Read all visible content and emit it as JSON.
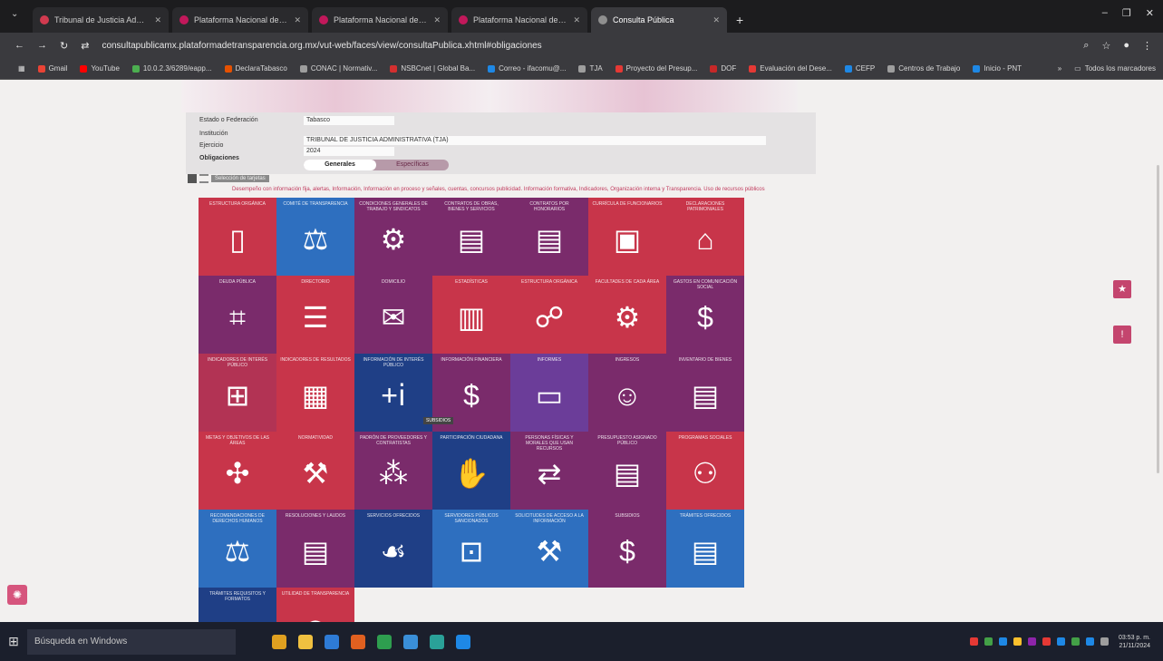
{
  "browser": {
    "tabs": [
      {
        "title": "Tribunal de Justicia Administr...",
        "color": "#d13a4f",
        "active": false
      },
      {
        "title": "Plataforma Nacional de Transp...",
        "color": "#c2185b",
        "active": false
      },
      {
        "title": "Plataforma Nacional de Transp...",
        "color": "#c2185b",
        "active": false
      },
      {
        "title": "Plataforma Nacional de Transp...",
        "color": "#c2185b",
        "active": false
      },
      {
        "title": "Consulta Pública",
        "color": "#8f8f8f",
        "active": true
      }
    ],
    "new_tab": "+",
    "window_controls": {
      "minimize": "–",
      "maximize": "❐",
      "close": "✕"
    },
    "url": "consultapublicamx.plataformadetransparencia.org.mx/vut-web/faces/view/consultaPublica.xhtml#obligaciones",
    "bookmarks": [
      {
        "label": "Gmail",
        "color": "#ea4335"
      },
      {
        "label": "YouTube",
        "color": "#ff0000"
      },
      {
        "label": "10.0.2.3/6289/eapp...",
        "color": "#4caf50"
      },
      {
        "label": "DeclaraTabasco",
        "color": "#e65100"
      },
      {
        "label": "CONAC | Normativ...",
        "color": "#9e9e9e"
      },
      {
        "label": "NSBCnet | Global Ba...",
        "color": "#d32f2f"
      },
      {
        "label": "Correo - ifacomu@...",
        "color": "#1e88e5"
      },
      {
        "label": "TJA",
        "color": "#9e9e9e"
      },
      {
        "label": "Proyecto del Presup...",
        "color": "#e53935"
      },
      {
        "label": "DOF",
        "color": "#c62828"
      },
      {
        "label": "Evaluación del Dese...",
        "color": "#e53935"
      },
      {
        "label": "CEFP",
        "color": "#1e88e5"
      },
      {
        "label": "Centros de Trabajo",
        "color": "#9e9e9e"
      },
      {
        "label": "Inicio - PNT",
        "color": "#1e88e5"
      }
    ],
    "all_bookmarks": "Todos los marcadores"
  },
  "form": {
    "labels": {
      "estado": "Estado o Federación",
      "institucion": "Institución",
      "ejercicio": "Ejercicio",
      "obligaciones": "Obligaciones"
    },
    "values": {
      "estado": "Tabasco",
      "institucion": "TRIBUNAL DE JUSTICIA ADMINISTRATIVA (TJA)",
      "ejercicio": "2024"
    },
    "tabs": {
      "generales": "Generales",
      "especificas": "Específicas"
    },
    "select_button": "Selección de tarjetas",
    "legend": "Desempeño con información fija, alertas, Información, Información en proceso y señales, cuentas, concursos publicidad. Información formativa, Indicadores, Organización interna y Transparencia. Uso de recursos públicos"
  },
  "tiles": [
    {
      "label": "Estructura Orgánica",
      "color": "#c8354a",
      "icon": "▯"
    },
    {
      "label": "Comité de Transparencia",
      "color": "#2e6fbf",
      "icon": "⚖"
    },
    {
      "label": "Condiciones generales de trabajo y sindicatos",
      "color": "#7a2b6b",
      "icon": "⚙"
    },
    {
      "label": "Contratos de obras, bienes y servicios",
      "color": "#7a2b6b",
      "icon": "▤"
    },
    {
      "label": "Contratos por honorarios",
      "color": "#7a2b6b",
      "icon": "▤"
    },
    {
      "label": "Currícula de funcionarios",
      "color": "#c8354a",
      "icon": "▣"
    },
    {
      "label": "Declaraciones patrimoniales",
      "color": "#c8354a",
      "icon": "⌂"
    },
    {
      "label": "Deuda pública",
      "color": "#7a2b6b",
      "icon": "⌗"
    },
    {
      "label": "Directorio",
      "color": "#c8354a",
      "icon": "☰"
    },
    {
      "label": "Domicilio",
      "color": "#7a2b6b",
      "icon": "✉"
    },
    {
      "label": "Estadísticas",
      "color": "#c8354a",
      "icon": "▥"
    },
    {
      "label": "Estructura orgánica",
      "color": "#c8354a",
      "icon": "☍"
    },
    {
      "label": "Facultades de cada área",
      "color": "#c8354a",
      "icon": "⚙"
    },
    {
      "label": "Gastos en comunicación social",
      "color": "#7a2b6b",
      "icon": "$"
    },
    {
      "label": "Indicadores de interés público",
      "color": "#b23354",
      "icon": "⊞"
    },
    {
      "label": "Indicadores de resultados",
      "color": "#c8354a",
      "icon": "▦"
    },
    {
      "label": "Información de interés público",
      "color": "#1f3f86",
      "icon": "+ⅰ"
    },
    {
      "label": "Información financiera",
      "color": "#7a2b6b",
      "icon": "$"
    },
    {
      "label": "Informes",
      "color": "#6b3d99",
      "icon": "▭"
    },
    {
      "label": "Ingresos",
      "color": "#7a2b6b",
      "icon": "☺"
    },
    {
      "label": "Inventario de bienes",
      "color": "#7a2b6b",
      "icon": "▤"
    },
    {
      "label": "Metas y objetivos de las áreas",
      "color": "#c8354a",
      "icon": "✣"
    },
    {
      "label": "Normatividad",
      "color": "#c8354a",
      "icon": "⚒"
    },
    {
      "label": "Padrón de proveedores y contratistas",
      "color": "#7a2b6b",
      "icon": "⁂"
    },
    {
      "label": "Participación ciudadana",
      "color": "#1f3f86",
      "icon": "✋"
    },
    {
      "label": "Personas físicas y morales que usan recursos",
      "color": "#7a2b6b",
      "icon": "⇄"
    },
    {
      "label": "Presupuesto asignado público",
      "color": "#7a2b6b",
      "icon": "▤"
    },
    {
      "label": "Programas sociales",
      "color": "#c8354a",
      "icon": "⚇"
    },
    {
      "label": "Recomendaciones de derechos humanos",
      "color": "#2e6fbf",
      "icon": "⚖"
    },
    {
      "label": "Resoluciones y laudos",
      "color": "#7a2b6b",
      "icon": "▤"
    },
    {
      "label": "Servicios ofrecidos",
      "color": "#1f3f86",
      "icon": "☙"
    },
    {
      "label": "Servidores públicos sancionados",
      "color": "#2e6fbf",
      "icon": "⊡"
    },
    {
      "label": "Solicitudes de acceso a la información",
      "color": "#2e6fbf",
      "icon": "⚒"
    },
    {
      "label": "Subsidios",
      "color": "#7a2b6b",
      "icon": "$"
    },
    {
      "label": "Trámites ofrecidos",
      "color": "#2e6fbf",
      "icon": "▤"
    },
    {
      "label": "Trámites requisitos y formatos",
      "color": "#1f3f86",
      "icon": "▭"
    },
    {
      "label": "Utilidad de Transparencia",
      "color": "#c8354a",
      "icon": "◎"
    }
  ],
  "tooltip": "SUBSIDIOS",
  "side_buttons": {
    "favorite": "★",
    "alert": "!"
  },
  "accessibility_icon": "✺",
  "taskbar": {
    "start": "⊞",
    "search_placeholder": "Búsqueda en Windows",
    "apps": [
      "#e0a020",
      "#f0c040",
      "#2e7bd6",
      "#e06020",
      "#2e9e4f",
      "#3a8fd8",
      "#2aa198",
      "#1e88e5"
    ],
    "tray": [
      "#e53935",
      "#43a047",
      "#1e88e5",
      "#fbc02d",
      "#8e24aa",
      "#e53935",
      "#1e88e5",
      "#43a047",
      "#1e88e5",
      "#9e9e9e"
    ],
    "time": "03:53 p. m.",
    "date": "21/11/2024"
  }
}
